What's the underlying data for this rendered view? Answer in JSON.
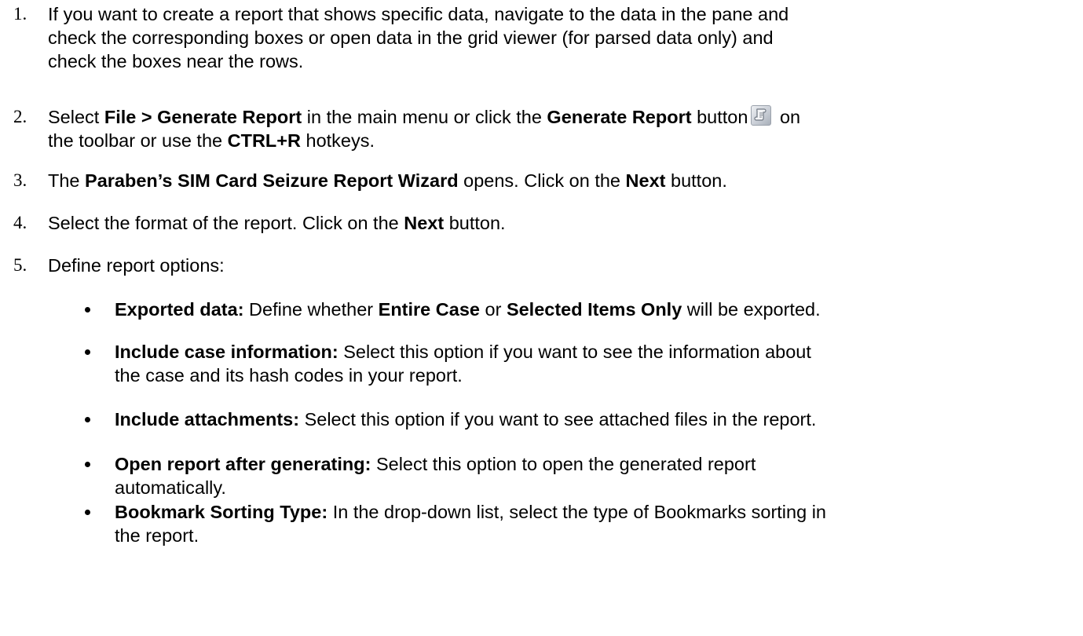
{
  "steps": [
    {
      "num": "1.",
      "lines": [
        "If you want to create a report that shows specific data, navigate to the data in the pane and",
        "check the corresponding boxes or open data in the grid viewer (for parsed data only) and",
        "check the boxes near the rows."
      ]
    },
    {
      "num": "2.",
      "t1": "Select ",
      "b1": "File > Generate Report",
      "t2": " in the main menu or click the ",
      "b2": "Generate Report",
      "t3": " button",
      "t4": " on",
      "t5": "the toolbar or use the ",
      "b3": "CTRL+R",
      "t6": " hotkeys."
    },
    {
      "num": "3.",
      "t1": "The ",
      "b1": "Paraben’s SIM Card Seizure Report Wizard",
      "t2": " opens. Click on the ",
      "b2": "Next",
      "t3": " button."
    },
    {
      "num": "4.",
      "t1": "Select the format of the report. Click on the ",
      "b1": "Next",
      "t2": " button."
    },
    {
      "num": "5.",
      "t1": "Define report options:"
    }
  ],
  "options": [
    {
      "label": "Exported data:",
      "t1": " Define whether ",
      "b1": "Entire Case",
      "t2": " or ",
      "b2": "Selected Items Only",
      "t3": " will be exported."
    },
    {
      "label": "Include case information:",
      "l1": " Select this option if you want to see the information about",
      "l2": "the case and its hash codes in your report."
    },
    {
      "label": "Include attachments:",
      "t1": " Select this option if you want to see attached files in the report."
    },
    {
      "label": "Open report after generating:",
      "l1": " Select this option to open the generated report",
      "l2": "automatically."
    },
    {
      "label": "Bookmark Sorting Type:",
      "l1": " In the drop-down list, select the type of Bookmarks sorting in",
      "l2": "the report."
    }
  ],
  "icons": {
    "generate_report": "report-scroll-icon"
  }
}
